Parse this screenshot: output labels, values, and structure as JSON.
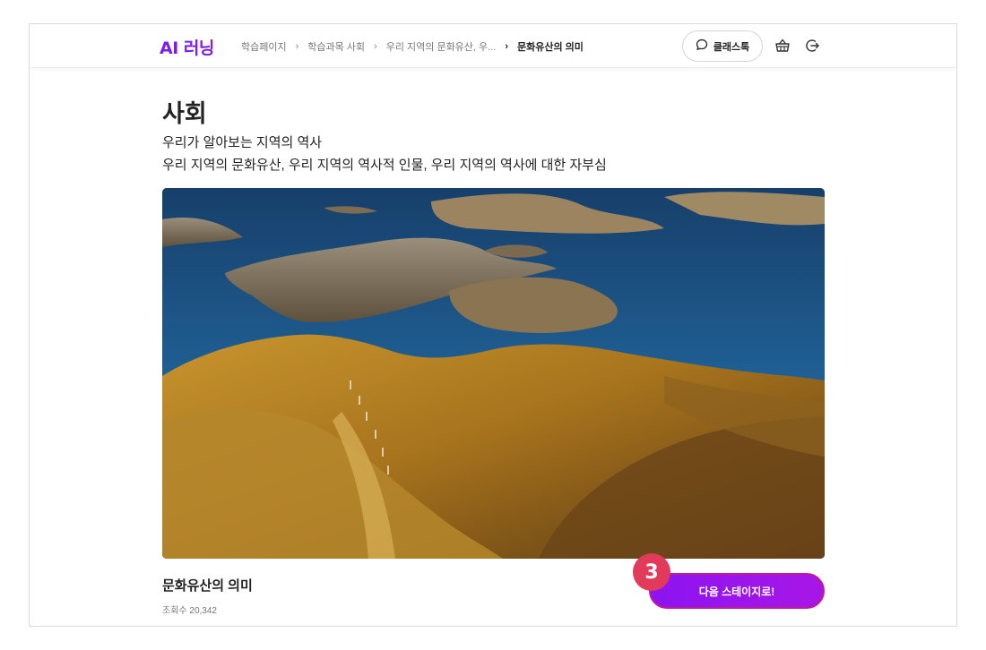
{
  "header": {
    "logo": "AI 러닝",
    "breadcrumb": [
      "학습페이지",
      "학습과목 사회",
      "우리 지역의 문화유산, 우...",
      "문화유산의 의미"
    ],
    "chat_label": "클래스톡",
    "icons": [
      "chat-bubble-icon",
      "basket-icon",
      "logout-icon"
    ]
  },
  "main": {
    "title": "사회",
    "subtitle_line1": "우리가 알아보는 지역의 역사",
    "subtitle_line2": "우리 지역의 문화유산, 우리 지역의 역사적 인물, 우리 지역의 역사에 대한 자부심",
    "lesson_title": "문화유산의 의미",
    "views": "조회수 20,342",
    "next_button": "다음 스테이지로!",
    "step_badge": "3"
  },
  "colors": {
    "brand": "#7b1df0",
    "button": "#8c14f0",
    "badge": "#e23a5a"
  }
}
